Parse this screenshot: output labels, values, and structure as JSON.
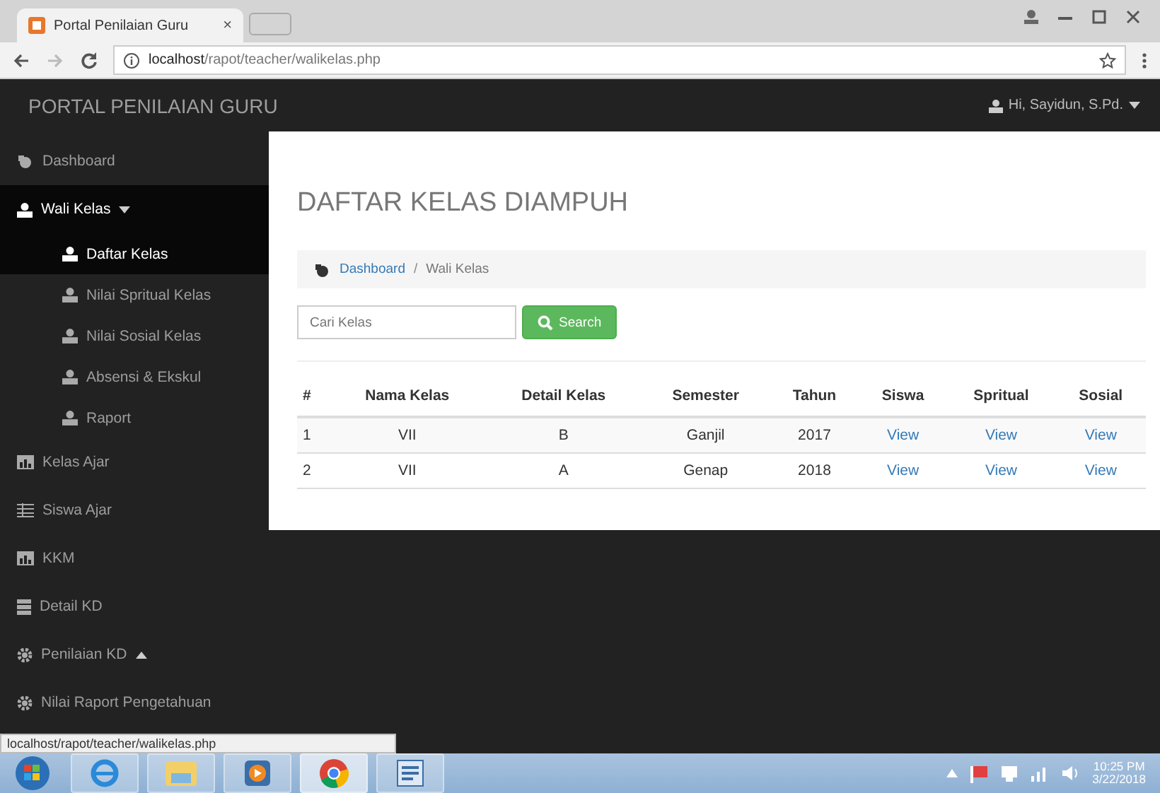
{
  "browser": {
    "tab_title": "Portal Penilaian Guru",
    "tab_close": "×",
    "url_host": "localhost",
    "url_path": "/rapot/teacher/walikelas.php"
  },
  "navbar": {
    "brand": "PORTAL PENILAIAN GURU",
    "user": "Hi, Sayidun, S.Pd."
  },
  "sidebar": {
    "items": [
      {
        "label": "Dashboard",
        "selected": false
      },
      {
        "label": "Wali Kelas",
        "selected": true,
        "expanded": true,
        "children": [
          {
            "label": "Daftar Kelas",
            "selected": true
          },
          {
            "label": "Nilai Spritual Kelas",
            "selected": false
          },
          {
            "label": "Nilai Sosial Kelas",
            "selected": false
          },
          {
            "label": "Absensi & Ekskul",
            "selected": false
          },
          {
            "label": "Raport",
            "selected": false
          }
        ]
      },
      {
        "label": "Kelas Ajar",
        "selected": false
      },
      {
        "label": "Siswa Ajar",
        "selected": false
      },
      {
        "label": "KKM",
        "selected": false
      },
      {
        "label": "Detail KD",
        "selected": false
      },
      {
        "label": "Penilaian KD",
        "selected": false,
        "expanded": false
      },
      {
        "label": "Nilai Raport Pengetahuan",
        "selected": false
      }
    ]
  },
  "page": {
    "title": "DAFTAR KELAS DIAMPUH",
    "breadcrumb": [
      "Dashboard",
      "Wali Kelas"
    ],
    "breadcrumb_separator": "/",
    "search": {
      "placeholder": "Cari Kelas",
      "button": "Search"
    },
    "table": {
      "columns": [
        "#",
        "Nama Kelas",
        "Detail Kelas",
        "Semester",
        "Tahun",
        "Siswa",
        "Spritual",
        "Sosial"
      ],
      "rows": [
        [
          "1",
          "VII",
          "B",
          "Ganjil",
          "2017",
          "View",
          "View",
          "View"
        ],
        [
          "2",
          "VII",
          "A",
          "Genap",
          "2018",
          "View",
          "View",
          "View"
        ]
      ]
    }
  },
  "status_url": "localhost/rapot/teacher/walikelas.php",
  "taskbar": {
    "time": "10:25 PM",
    "date": "3/22/2018"
  }
}
